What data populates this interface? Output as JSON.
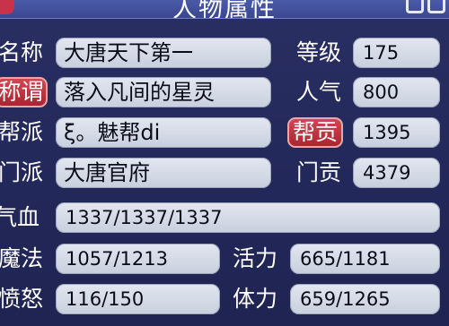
{
  "window": {
    "title": "人物属性"
  },
  "rows": {
    "name": {
      "label": "名称",
      "value": "大唐天下第一"
    },
    "title": {
      "label": "称谓",
      "value": "落入凡间的星灵"
    },
    "guild": {
      "label": "帮派",
      "value": "ξ。魅帮di"
    },
    "school": {
      "label": "门派",
      "value": "大唐官府"
    },
    "hp": {
      "label": "气血",
      "value": "1337/1337/1337"
    },
    "mp": {
      "label": "魔法",
      "value": "1057/1213"
    },
    "rage": {
      "label": "愤怒",
      "value": "116/150"
    }
  },
  "stats": {
    "level": {
      "label": "等级",
      "value": "175"
    },
    "popularity": {
      "label": "人气",
      "value": "800"
    },
    "contribution": {
      "label": "帮贡",
      "value": "1395"
    },
    "school_contribution": {
      "label": "门贡",
      "value": "4379"
    },
    "vitality": {
      "label": "活力",
      "value": "665/1181"
    },
    "stamina": {
      "label": "体力",
      "value": "659/1265"
    }
  },
  "colors": {
    "background": "#23285a",
    "field": "#d8dde8",
    "accent_red": "#b8303c",
    "title_bar": "#3f4c97"
  }
}
